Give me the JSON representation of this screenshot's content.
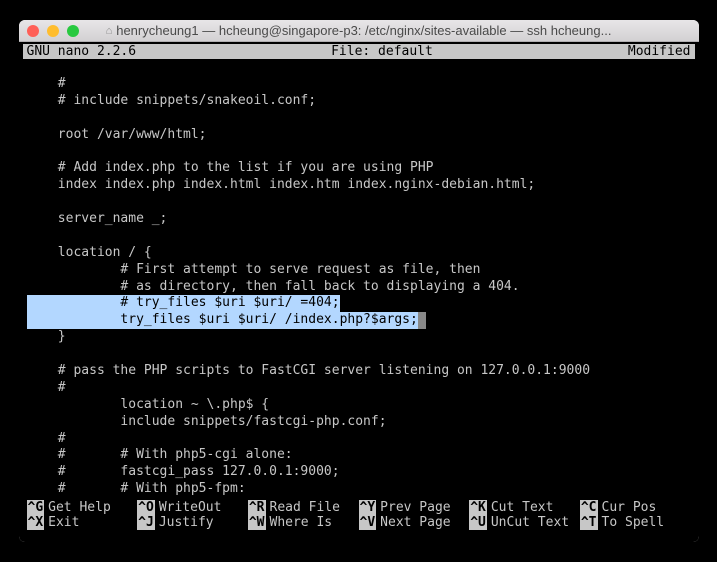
{
  "window": {
    "title": "henrycheung1 — hcheung@singapore-p3: /etc/nginx/sites-available — ssh hcheung..."
  },
  "nano": {
    "version": "GNU nano 2.2.6",
    "file_label": "File: default",
    "status": "Modified"
  },
  "lines": [
    "    #",
    "    # include snippets/snakeoil.conf;",
    "",
    "    root /var/www/html;",
    "",
    "    # Add index.php to the list if you are using PHP",
    "    index index.php index.html index.htm index.nginx-debian.html;",
    "",
    "    server_name _;",
    "",
    "    location / {",
    "            # First attempt to serve request as file, then",
    "            # as directory, then fall back to displaying a 404.",
    "            # try_files $uri $uri/ =404;",
    "            try_files $uri $uri/ /index.php?$args;",
    "    }",
    "",
    "    # pass the PHP scripts to FastCGI server listening on 127.0.0.1:9000",
    "    #",
    "            location ~ \\.php$ {",
    "            include snippets/fastcgi-php.conf;",
    "    #",
    "    #       # With php5-cgi alone:",
    "    #       fastcgi_pass 127.0.0.1:9000;",
    "    #       # With php5-fpm:"
  ],
  "highlighted_indices": [
    13,
    14
  ],
  "cursor_line": 14,
  "shortcuts": [
    {
      "key": "^G",
      "label": "Get Help"
    },
    {
      "key": "^X",
      "label": "Exit"
    },
    {
      "key": "^O",
      "label": "WriteOut"
    },
    {
      "key": "^J",
      "label": "Justify"
    },
    {
      "key": "^R",
      "label": "Read File"
    },
    {
      "key": "^W",
      "label": "Where Is"
    },
    {
      "key": "^Y",
      "label": "Prev Page"
    },
    {
      "key": "^V",
      "label": "Next Page"
    },
    {
      "key": "^K",
      "label": "Cut Text"
    },
    {
      "key": "^U",
      "label": "UnCut Text"
    },
    {
      "key": "^C",
      "label": "Cur Pos"
    },
    {
      "key": "^T",
      "label": "To Spell"
    }
  ]
}
